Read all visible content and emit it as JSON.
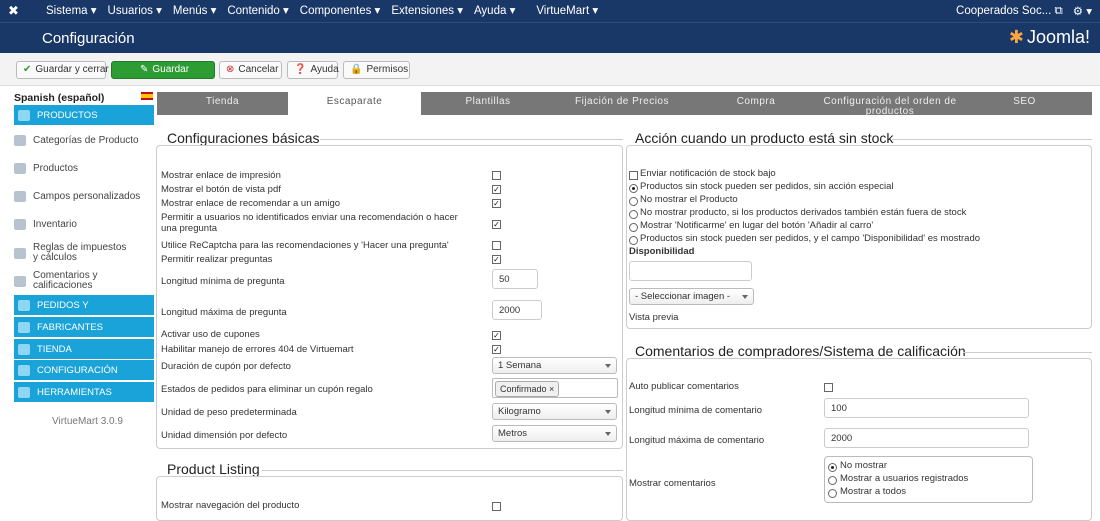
{
  "topbar": {
    "menu": [
      "Sistema ▾",
      "Usuarios ▾",
      "Menús ▾",
      "Contenido ▾",
      "Componentes ▾",
      "Extensiones ▾",
      "Ayuda ▾",
      "VirtueMart ▾"
    ],
    "user": "Cooperados Soc...",
    "gear": "⚙ ▾"
  },
  "header": {
    "title": "Configuración",
    "brand": "Joomla!"
  },
  "toolbar": {
    "save_close": "Guardar y cerrar",
    "save": "Guardar",
    "cancel": "Cancelar",
    "help": "Ayuda",
    "permissions": "Permisos"
  },
  "sidebar": {
    "language": "Spanish (español)",
    "productos": "PRODUCTOS",
    "items": [
      "Categorías de Producto",
      "Productos",
      "Campos personalizados",
      "Inventario",
      "Reglas de impuestos y cálculos",
      "Comentarios y calificaciones"
    ],
    "sections": [
      "PEDIDOS Y",
      "FABRICANTES",
      "TIENDA",
      "CONFIGURACIÓN",
      "HERRAMIENTAS"
    ],
    "version": "VirtueMart 3.0.9"
  },
  "tabs": [
    "Tienda",
    "Escaparate",
    "Plantillas",
    "Fijación de Precios",
    "Compra",
    "Configuración del orden de productos",
    "SEO"
  ],
  "basic": {
    "title": "Configuraciones básicas",
    "rows": [
      "Mostrar enlace de impresión",
      "Mostrar el botón de vista pdf",
      "Mostrar enlace de recomendar a un amigo",
      "Permitir a usuarios no identificados enviar una recomendación o hacer una pregunta",
      "Utilice ReCaptcha para las recomendaciones y 'Hacer una pregunta'",
      "Permitir realizar preguntas"
    ],
    "min_q_label": "Longitud mínima de pregunta",
    "min_q_value": "50",
    "max_q_label": "Longitud máxima de pregunta",
    "max_q_value": "2000",
    "coupons": "Activar uso de cupones",
    "err404": "Habilitar manejo de errores 404 de Virtuemart",
    "coupon_dur_label": "Duración de cupón por defecto",
    "coupon_dur_value": "1 Semana",
    "order_states_label": "Estados de pedidos para eliminar un cupón regalo",
    "order_states_tag": "Confirmado ×",
    "weight_label": "Unidad de peso predeterminada",
    "weight_value": "Kilogramo",
    "dim_label": "Unidad dimensión por defecto",
    "dim_value": "Metros"
  },
  "listing": {
    "title": "Product Listing",
    "row": "Mostrar navegación del producto"
  },
  "stock": {
    "title": "Acción cuando un producto está sin stock",
    "notify": "Enviar notificación de stock bajo",
    "options": [
      "Productos sin stock pueden ser pedidos, sin acción especial",
      "No mostrar el Producto",
      "No mostrar producto, si los productos derivados también están fuera de stock",
      "Mostrar 'Notificarme' en lugar del botón 'Añadir al carro'",
      "Productos sin stock pueden ser pedidos, y el campo 'Disponibilidad' es mostrado"
    ],
    "availability": "Disponibilidad",
    "select_image": "- Seleccionar imagen -",
    "preview": "Vista previa"
  },
  "reviews": {
    "title": "Comentarios de compradores/Sistema de calificación",
    "auto_publish": "Auto publicar comentarios",
    "min_label": "Longitud mínima de comentario",
    "min_value": "100",
    "max_label": "Longitud máxima de comentario",
    "max_value": "2000",
    "show_label": "Mostrar comentarios",
    "show_options": [
      "No mostrar",
      "Mostrar a usuarios registrados",
      "Mostrar a todos"
    ]
  }
}
